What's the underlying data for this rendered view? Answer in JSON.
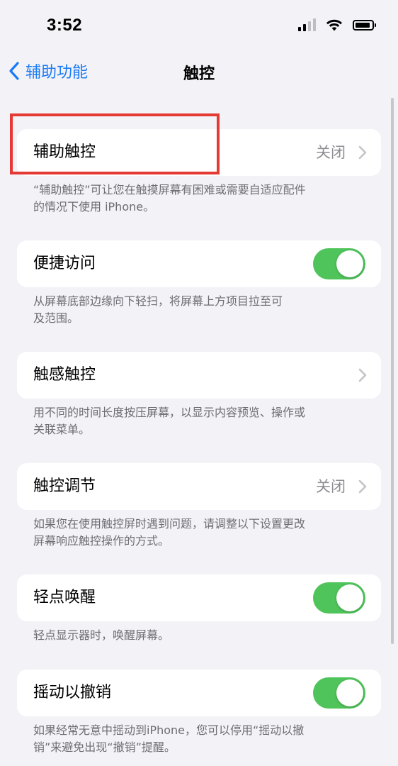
{
  "status_bar": {
    "time": "3:52",
    "icons": [
      "cellular-signal-icon",
      "wifi-icon",
      "battery-icon"
    ]
  },
  "nav": {
    "back_label": "辅助功能",
    "title": "触控"
  },
  "colors": {
    "accent": "#1a7af6",
    "toggle_on": "#4fc45a",
    "highlight": "#e53a33",
    "background": "#f2f2f7"
  },
  "sections": [
    {
      "title": "辅助触控",
      "detail": "关闭",
      "control": "chevron",
      "footer_lines": [
        "“辅助触控”可让您在触摸屏幕有困难或需要自适应配件",
        "的情况下使用 iPhone。"
      ]
    },
    {
      "title": "便捷访问",
      "control": "toggle",
      "toggle_on": true,
      "footer_lines": [
        "从屏幕底部边缘向下轻扫，将屏幕上方项目拉至可",
        "及范围。"
      ]
    },
    {
      "title": "触感触控",
      "detail": "",
      "control": "chevron",
      "footer_lines": [
        "用不同的时间长度按压屏幕，以显示内容预览、操作或",
        "关联菜单。"
      ]
    },
    {
      "title": "触控调节",
      "detail": "关闭",
      "control": "chevron",
      "footer_lines": [
        "如果您在使用触控屏时遇到问题，请调整以下设置更改",
        "屏幕响应触控操作的方式。"
      ]
    },
    {
      "title": "轻点唤醒",
      "control": "toggle",
      "toggle_on": true,
      "footer_lines": [
        "轻点显示器时，唤醒屏幕。"
      ]
    },
    {
      "title": "摇动以撤销",
      "control": "toggle",
      "toggle_on": true,
      "footer_lines": [
        "如果经常无意中摇动到iPhone，您可以停用“摇动以撤",
        "销”来避免出现“撤销”提醒。"
      ]
    }
  ]
}
